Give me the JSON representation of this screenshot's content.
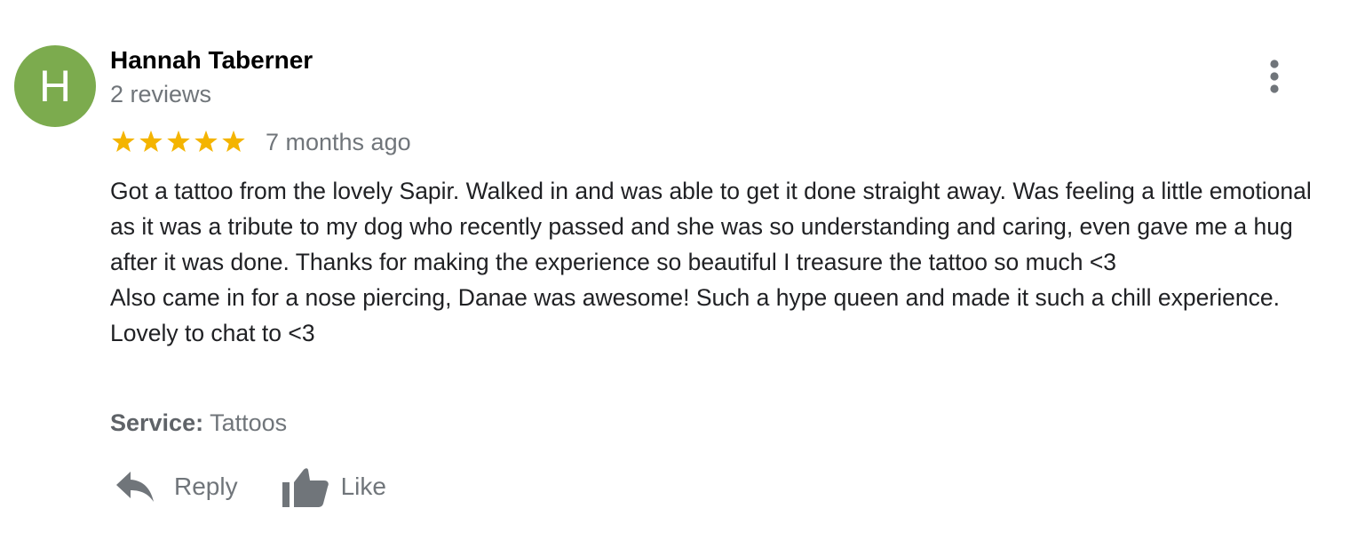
{
  "review": {
    "reviewer": {
      "initial": "H",
      "avatar_color": "#7cab4e",
      "name": "Hannah Taberner",
      "review_count": "2 reviews"
    },
    "rating": 5,
    "rating_max": 5,
    "star_color": "#f4b400",
    "time_ago": "7 months ago",
    "body": [
      "Got a tattoo from the lovely Sapir. Walked in and was able to get it done straight away. Was feeling a little emotional as it was a tribute to my dog who recently passed and she was so understanding and caring, even gave me a hug after it was done. Thanks for making the experience so beautiful I treasure the tattoo so much <3",
      "Also came in for a nose piercing, Danae was awesome! Such a hype queen and made it such a chill experience. Lovely to chat to <3"
    ],
    "service": {
      "label": "Service:",
      "value": "Tattoos"
    },
    "more_icon": "more-vert-icon",
    "actions": {
      "reply_label": "Reply",
      "reply_icon": "reply-arrow-icon",
      "like_label": "Like",
      "like_icon": "thumbs-up-icon"
    }
  }
}
